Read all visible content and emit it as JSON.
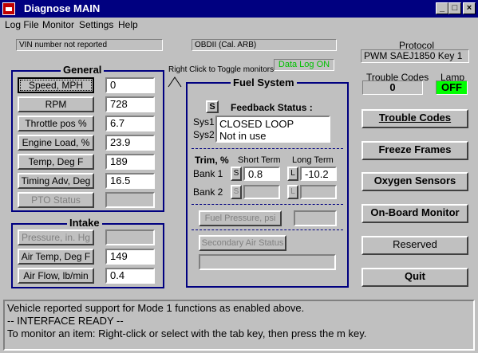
{
  "window": {
    "app_name": "Diagnose",
    "mode": "MAIN"
  },
  "menu": [
    "Log File",
    "Monitor",
    "Settings",
    "Help"
  ],
  "info": {
    "vin": "VIN number not reported",
    "obd": "OBDII (Cal. ARB)"
  },
  "protocol": {
    "label": "Protocol",
    "value": "PWM SAEJ1850 Key 1"
  },
  "trouble": {
    "label": "Trouble Codes",
    "value": "0",
    "lamp_label": "Lamp",
    "lamp_value": "OFF"
  },
  "hint": "Right Click to Toggle monitors",
  "datalog": "Data Log ON",
  "general": {
    "title": "General",
    "rows": [
      {
        "label": "Speed, MPH",
        "value": "0"
      },
      {
        "label": "RPM",
        "value": "728"
      },
      {
        "label": "Throttle pos %",
        "value": "6.7"
      },
      {
        "label": "Engine Load, %",
        "value": "23.9"
      },
      {
        "label": "Temp, Deg F",
        "value": "189"
      },
      {
        "label": "Timing Adv, Deg",
        "value": "16.5"
      },
      {
        "label": "PTO Status",
        "value": ""
      }
    ]
  },
  "intake": {
    "title": "Intake",
    "rows": [
      {
        "label": "Pressure, in. Hg",
        "value": ""
      },
      {
        "label": "Air Temp, Deg F",
        "value": "149"
      },
      {
        "label": "Air Flow, lb/min",
        "value": "0.4"
      }
    ]
  },
  "fuel": {
    "title": "Fuel System",
    "s_btn": "S",
    "feedback_label": "Feedback Status :",
    "sys1": "Sys1",
    "sys2": "Sys2",
    "sys1_val": "CLOSED LOOP",
    "sys2_val": "Not in use",
    "trim_label": "Trim, %",
    "short_term": "Short Term",
    "long_term": "Long Term",
    "bank1": "Bank 1",
    "bank2": "Bank 2",
    "s_small": "S",
    "l_small": "L",
    "bank1_short": "0.8",
    "bank1_long": "-10.2",
    "fuel_pressure": "Fuel Pressure, psi",
    "secondary_air": "Secondary Air Status"
  },
  "buttons": {
    "trouble_codes": "Trouble Codes",
    "freeze_frames": "Freeze Frames",
    "oxygen": "Oxygen Sensors",
    "onboard": "On-Board Monitor",
    "reserved": "Reserved",
    "quit": "Quit"
  },
  "status": {
    "line1": "Vehicle reported support for Mode 1 functions as enabled above.",
    "line2": "-- INTERFACE READY --",
    "line3": "To monitor an item:  Right-click or select with the tab key, then press the m key."
  },
  "colors": {
    "titlebar": "#000080",
    "group_border": "#000080",
    "datalog_green": "#00c000",
    "lamp_green": "#00ff00"
  }
}
